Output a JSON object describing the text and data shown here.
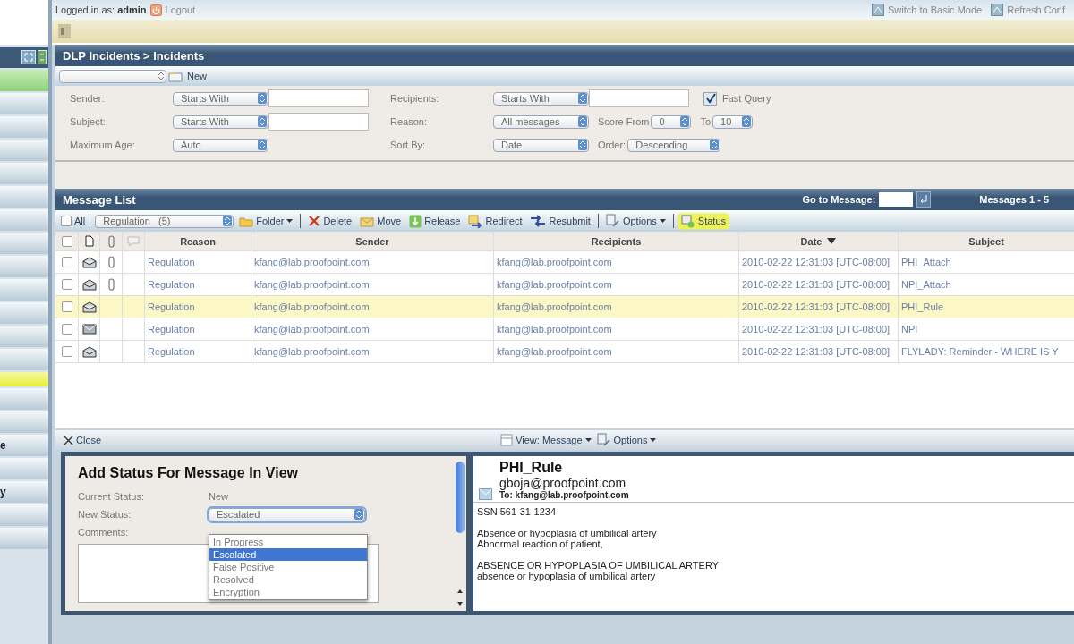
{
  "sidebar": {
    "items": [
      {
        "selected": true,
        "highlighted": false
      },
      {
        "selected": false,
        "highlighted": false
      },
      {
        "selected": false,
        "highlighted": false
      },
      {
        "selected": false,
        "highlighted": false
      },
      {
        "selected": false,
        "highlighted": false
      },
      {
        "selected": false,
        "highlighted": false
      },
      {
        "selected": false,
        "highlighted": false
      },
      {
        "selected": false,
        "highlighted": false
      },
      {
        "selected": false,
        "highlighted": false
      },
      {
        "selected": false,
        "highlighted": false
      },
      {
        "selected": false,
        "highlighted": false
      },
      {
        "selected": false,
        "highlighted": false
      },
      {
        "selected": false,
        "highlighted": false
      },
      {
        "selected": false,
        "highlighted": true
      },
      {
        "selected": false,
        "highlighted": false
      },
      {
        "selected": false,
        "highlighted": false
      },
      {
        "label": "e",
        "selected": false,
        "highlighted": false
      },
      {
        "selected": false,
        "highlighted": false
      },
      {
        "label": "y",
        "selected": false,
        "highlighted": false
      },
      {
        "selected": false,
        "highlighted": false
      },
      {
        "selected": false,
        "highlighted": false
      }
    ]
  },
  "top_bar": {
    "logged_in_label": "Logged in as:",
    "user": "admin",
    "logout": "Logout",
    "links": [
      "Switch to Basic Mode",
      "Refresh Conf"
    ]
  },
  "breadcrumb": "DLP Incidents > Incidents",
  "query_toolbar": {
    "new": "New"
  },
  "filters": {
    "sender": {
      "label": "Sender:",
      "match": "Starts With"
    },
    "subject": {
      "label": "Subject:",
      "match": "Starts With"
    },
    "max_age": {
      "label": "Maximum Age:",
      "value": "Auto"
    },
    "recipients": {
      "label": "Recipients:",
      "match": "Starts With"
    },
    "reason": {
      "label": "Reason:",
      "value": "All messages"
    },
    "sort_by": {
      "label": "Sort By:",
      "value": "Date"
    },
    "fast_query": {
      "label": "Fast Query",
      "checked": true
    },
    "score_from": {
      "label": "Score From",
      "value": "0"
    },
    "score_to": {
      "label": "To",
      "value": "10"
    },
    "order": {
      "label": "Order:",
      "value": "Descending"
    }
  },
  "message_list": {
    "title": "Message List",
    "goto_label": "Go to Message:",
    "count": "Messages 1 - 5",
    "header_checked": false,
    "toolbar": [
      [
        {
          "label": "All",
          "kind": "checkbox",
          "checked": false
        }
      ],
      [
        {
          "label": "Regulation   (5)",
          "kind": "dropdown"
        },
        {
          "label": "Folder",
          "kind": "button",
          "menu": true,
          "highlighted": false
        }
      ],
      [
        {
          "label": "Delete",
          "kind": "button",
          "menu": false,
          "highlighted": false
        },
        {
          "label": "Move",
          "kind": "button",
          "menu": false,
          "highlighted": false
        },
        {
          "label": "Release",
          "kind": "button",
          "menu": false,
          "highlighted": false
        },
        {
          "label": "Redirect",
          "kind": "button",
          "menu": false,
          "highlighted": false
        },
        {
          "label": "Resubmit",
          "kind": "button",
          "menu": false,
          "highlighted": false
        }
      ],
      [
        {
          "label": "Options",
          "kind": "button",
          "menu": true,
          "highlighted": false
        }
      ],
      [
        {
          "label": "Status",
          "kind": "button",
          "menu": false,
          "highlighted": true
        }
      ]
    ],
    "columns": [
      "Reason",
      "Sender",
      "Recipients",
      "Date",
      "Subject"
    ],
    "rows": [
      {
        "checked": false,
        "read": true,
        "attachment": true,
        "selected": false,
        "reason": "Regulation",
        "sender": "kfang@lab.proofpoint.com",
        "recipients": "kfang@lab.proofpoint.com",
        "date": "2010-02-22 12:31:03 [UTC-08:00]",
        "subject": "PHI_Attach"
      },
      {
        "checked": false,
        "read": true,
        "attachment": true,
        "selected": false,
        "reason": "Regulation",
        "sender": "kfang@lab.proofpoint.com",
        "recipients": "kfang@lab.proofpoint.com",
        "date": "2010-02-22 12:31:03 [UTC-08:00]",
        "subject": "NPI_Attach"
      },
      {
        "checked": false,
        "read": true,
        "attachment": false,
        "selected": true,
        "reason": "Regulation",
        "sender": "kfang@lab.proofpoint.com",
        "recipients": "kfang@lab.proofpoint.com",
        "date": "2010-02-22 12:31:03 [UTC-08:00]",
        "subject": "PHI_Rule"
      },
      {
        "checked": false,
        "read": false,
        "attachment": false,
        "selected": false,
        "reason": "Regulation",
        "sender": "kfang@lab.proofpoint.com",
        "recipients": "kfang@lab.proofpoint.com",
        "date": "2010-02-22 12:31:03 [UTC-08:00]",
        "subject": "NPI"
      },
      {
        "checked": false,
        "read": true,
        "attachment": false,
        "selected": false,
        "reason": "Regulation",
        "sender": "kfang@lab.proofpoint.com",
        "recipients": "kfang@lab.proofpoint.com",
        "date": "2010-02-22 12:31:03 [UTC-08:00]",
        "subject": "FLYLADY: Reminder - WHERE IS Y"
      }
    ]
  },
  "view_toolbar": {
    "close": "Close",
    "view": "View: Message",
    "options": "Options"
  },
  "status_panel": {
    "title": "Add Status For Message In View",
    "current_label": "Current Status:",
    "current_value": "New",
    "new_label": "New Status:",
    "new_value": "Escalated",
    "comments_label": "Comments:",
    "options": [
      {
        "label": "In Progress",
        "selected": false
      },
      {
        "label": "Escalated",
        "selected": true
      },
      {
        "label": "False Positive",
        "selected": false
      },
      {
        "label": "Resolved",
        "selected": false
      },
      {
        "label": "Encryption",
        "selected": false
      }
    ]
  },
  "message_view": {
    "subject": "PHI_Rule",
    "from": "gboja@proofpoint.com",
    "to": "To: kfang@lab.proofpoint.com",
    "paragraphs": [
      [
        "SSN 561-31-1234"
      ],
      [
        "Absence or hypoplasia of umbilical artery",
        "Abnormal reaction of patient,"
      ],
      [
        "ABSENCE OR HYPOPLASIA OF UMBILICAL ARTERY",
        "absence or hypoplasia of umbilical artery"
      ]
    ]
  }
}
